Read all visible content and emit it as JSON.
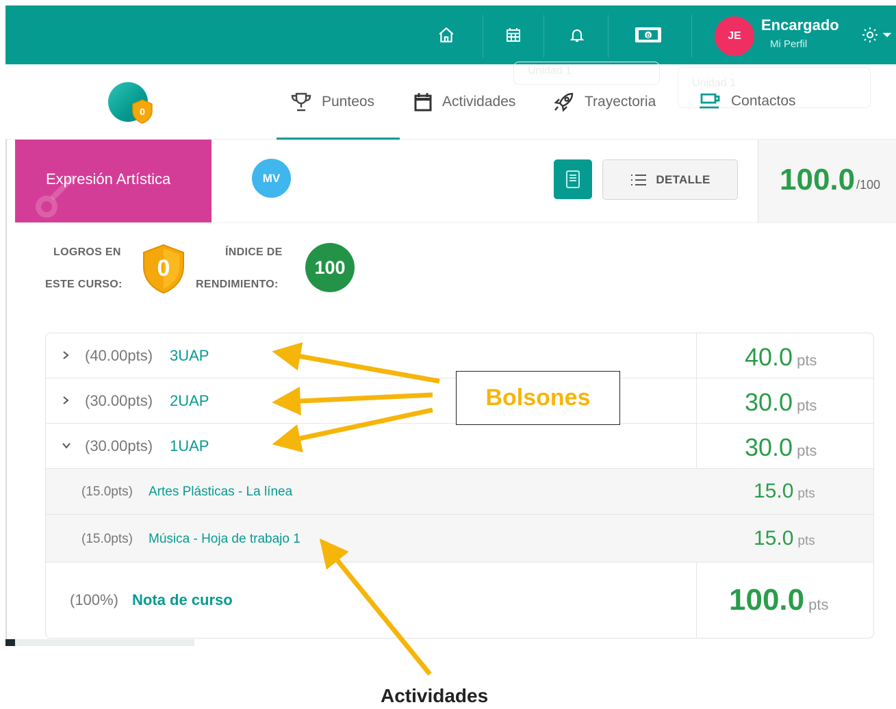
{
  "topbar": {
    "user_initials": "JE",
    "user_name": "Encargado",
    "user_link": "Mi Perfil",
    "icons": [
      "home-icon",
      "calendar-grid-icon",
      "bell-icon",
      "money-icon",
      "gear-icon"
    ],
    "bg_color": "#069b91",
    "avatar_color": "#ef2f62"
  },
  "subnav": {
    "logo_badge": "0",
    "tabs": [
      {
        "label": "Punteos",
        "icon": "trophy-icon"
      },
      {
        "label": "Actividades",
        "icon": "calendar-icon"
      },
      {
        "label": "Trayectoria",
        "icon": "rocket-icon"
      },
      {
        "label": "Contactos",
        "icon": "cup-icon"
      }
    ],
    "active_tab": "Punteos",
    "ghost_select_1": "Unidad 1",
    "ghost_select_2": "Unidad 1"
  },
  "course": {
    "title": "Expresión Artística",
    "teacher_initials": "MV",
    "detail_label": "DETALLE",
    "score": "100.0",
    "score_max": "/100",
    "color": "#d43d97"
  },
  "stats": {
    "logros_line1": "LOGROS EN",
    "logros_line2": "ESTE CURSO:",
    "logros_value": "0",
    "indice_line1": "ÍNDICE DE",
    "indice_line2": "RENDIMIENTO:",
    "indice_value": "100"
  },
  "table": {
    "unit": "pts",
    "groups": [
      {
        "weight": "(40.00pts)",
        "name": "3UAP",
        "value": "40.0",
        "expanded": false
      },
      {
        "weight": "(30.00pts)",
        "name": "2UAP",
        "value": "30.0",
        "expanded": false
      },
      {
        "weight": "(30.00pts)",
        "name": "1UAP",
        "value": "30.0",
        "expanded": true
      }
    ],
    "activities": [
      {
        "weight": "(15.0pts)",
        "name": "Artes Plásticas - La línea",
        "value": "15.0"
      },
      {
        "weight": "(15.0pts)",
        "name": "Música - Hoja de trabajo 1",
        "value": "15.0"
      }
    ],
    "total": {
      "weight": "(100%)",
      "name": "Nota de curso",
      "value": "100.0"
    }
  },
  "annotations": {
    "bolsones": "Bolsones",
    "actividades": "Actividades",
    "arrow_color": "#f5b50b"
  }
}
